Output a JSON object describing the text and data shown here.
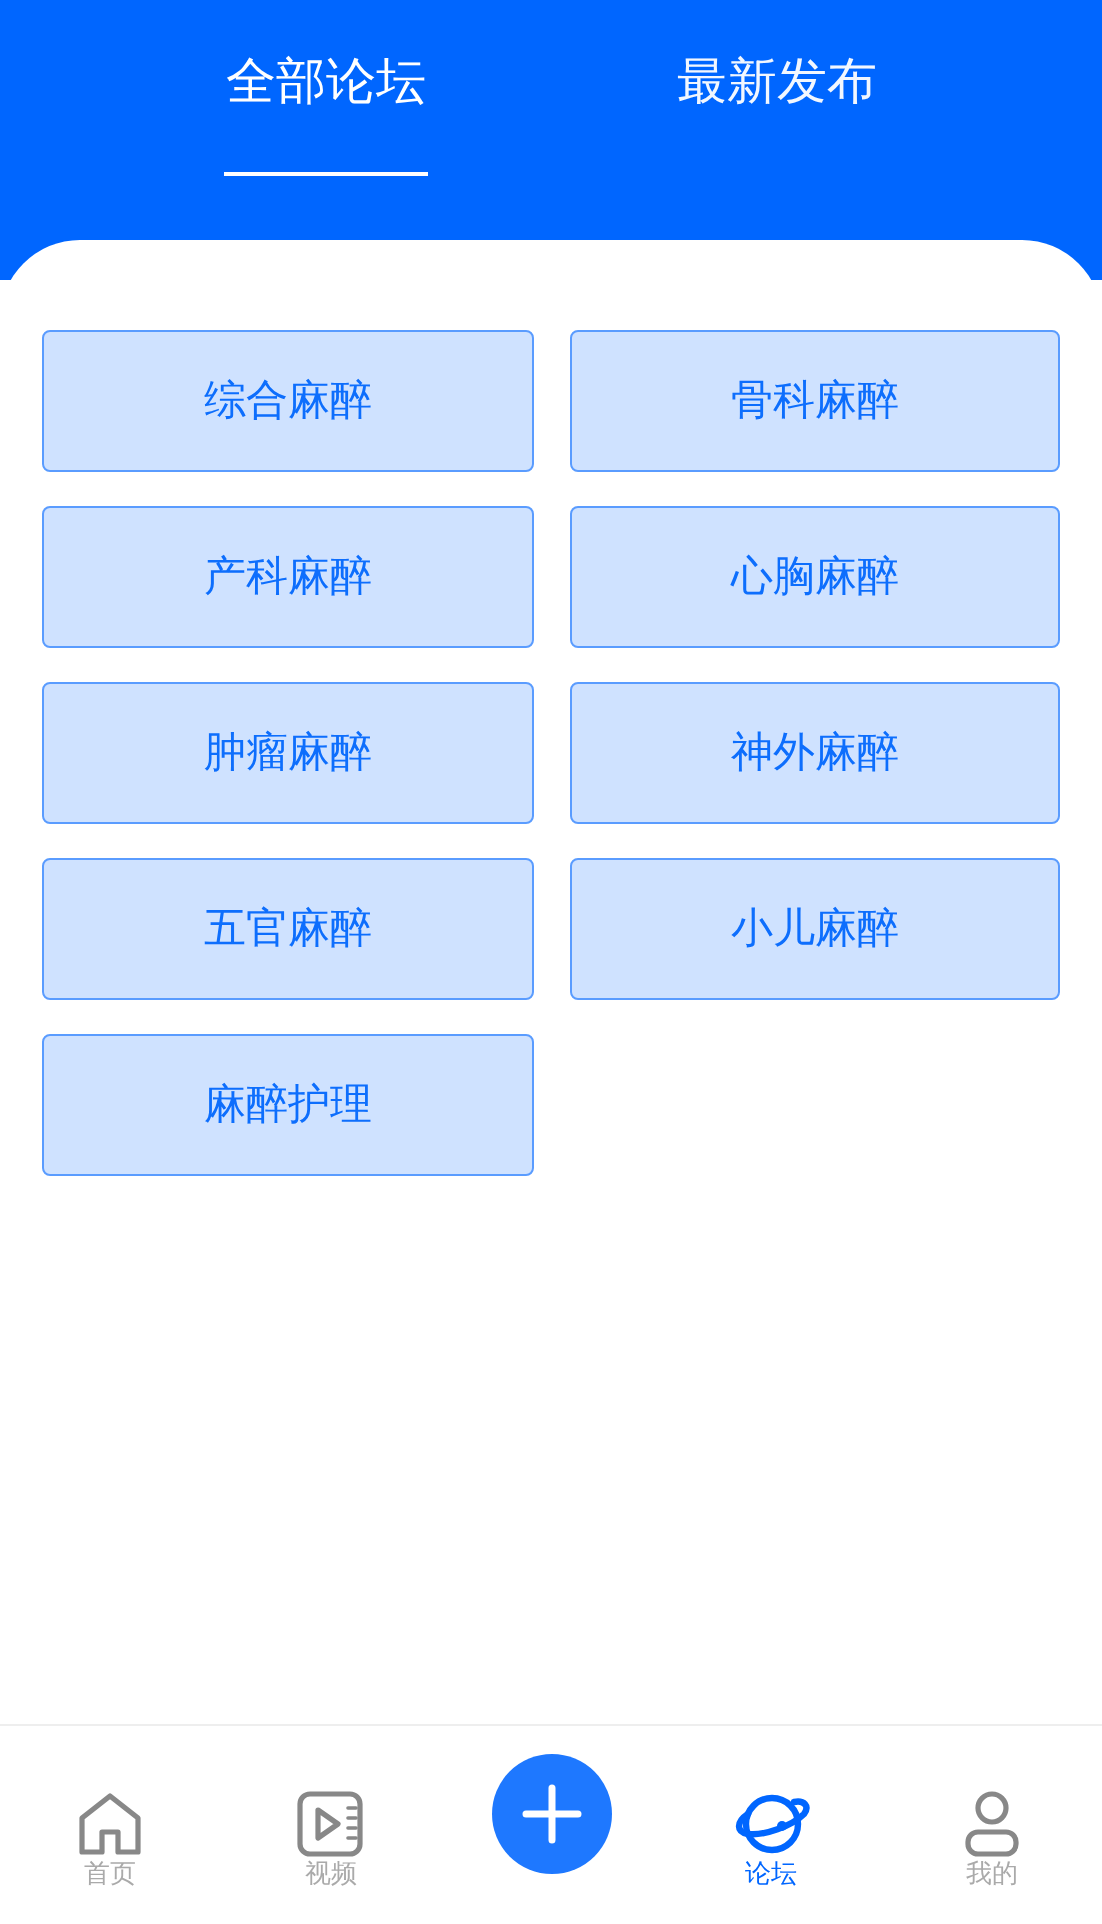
{
  "tabs": [
    {
      "label": "全部论坛",
      "selected": true
    },
    {
      "label": "最新发布",
      "selected": false
    }
  ],
  "forums": [
    "综合麻醉",
    "骨科麻醉",
    "产科麻醉",
    "心胸麻醉",
    "肿瘤麻醉",
    "神外麻醉",
    "五官麻醉",
    "小儿麻醉",
    "麻醉护理"
  ],
  "bottom_nav": [
    {
      "kind": "home",
      "label": "首页",
      "selected": false
    },
    {
      "kind": "video",
      "label": "视频",
      "selected": false
    },
    {
      "kind": "add",
      "selected": false
    },
    {
      "kind": "forum",
      "label": "论坛",
      "selected": true
    },
    {
      "kind": "me",
      "label": "我的",
      "selected": false
    }
  ]
}
